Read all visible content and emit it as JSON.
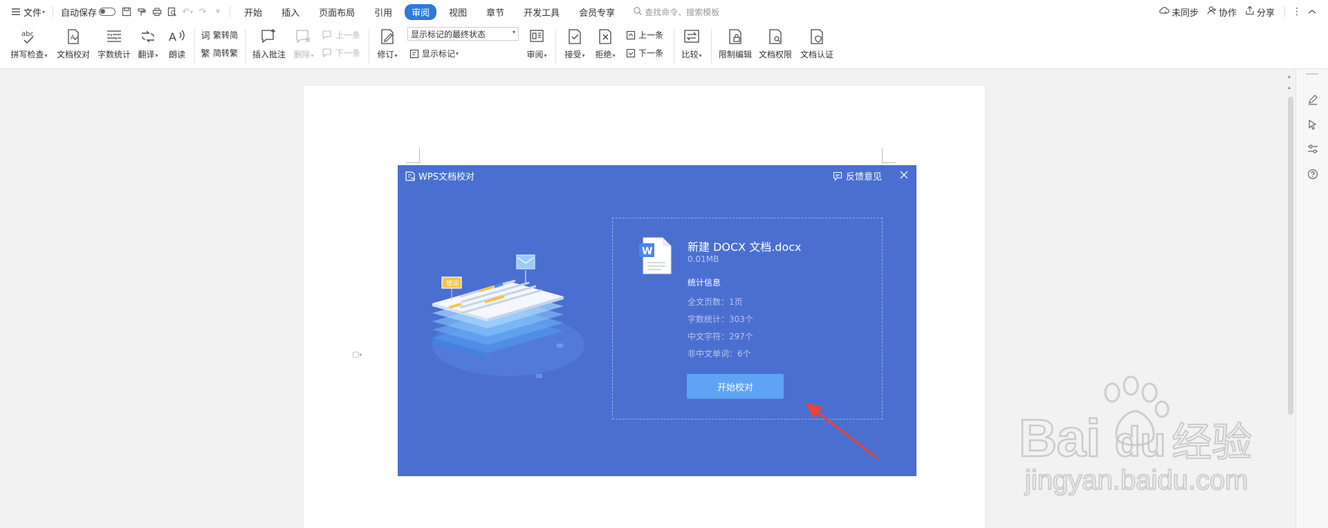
{
  "menubar": {
    "file_label": "文件",
    "autosave_label": "自动保存",
    "tabs": [
      "开始",
      "插入",
      "页面布局",
      "引用",
      "审阅",
      "视图",
      "章节",
      "开发工具",
      "会员专享"
    ],
    "active_tab": "审阅",
    "search_placeholder": "查找命令、搜索模板",
    "sync_label": "未同步",
    "collab_label": "协作",
    "share_label": "分享"
  },
  "ribbon": {
    "spell_check": "拼写检查",
    "doc_proofread": "文档校对",
    "word_count": "字数统计",
    "translate": "翻译",
    "read_aloud": "朗读",
    "trad_to_simp": "繁转简",
    "simp_to_trad": "简转繁",
    "insert_comment": "插入批注",
    "delete": "删除",
    "prev_comment": "上一条",
    "next_comment": "下一条",
    "track_changes": "修订",
    "markup_mode": "显示标记的最终状态",
    "show_markup": "显示标记",
    "review": "审阅",
    "accept": "接受",
    "reject": "拒绝",
    "prev_change": "上一条",
    "next_change": "下一条",
    "compare": "比较",
    "restrict_edit": "限制编辑",
    "doc_permission": "文档权限",
    "doc_certify": "文档认证"
  },
  "dialog": {
    "title": "WPS文档校对",
    "feedback": "反馈意见",
    "illustration_tag": "错词",
    "file_name": "新建 DOCX 文档.docx",
    "file_size": "0.01MB",
    "stats_title": "统计信息",
    "stats": [
      "全文页数：1页",
      "字数统计：303个",
      "中文字符：297个",
      "非中文单词：6个"
    ],
    "start_button": "开始校对"
  },
  "watermark": {
    "brand": "Baidu经验",
    "url": "jingyan.baidu.com"
  },
  "colors": {
    "dialog_bg": "#4a6fd1",
    "start_button": "#5fa3f5",
    "active_tab": "#2f7ad9",
    "arrow": "#e8443a"
  }
}
